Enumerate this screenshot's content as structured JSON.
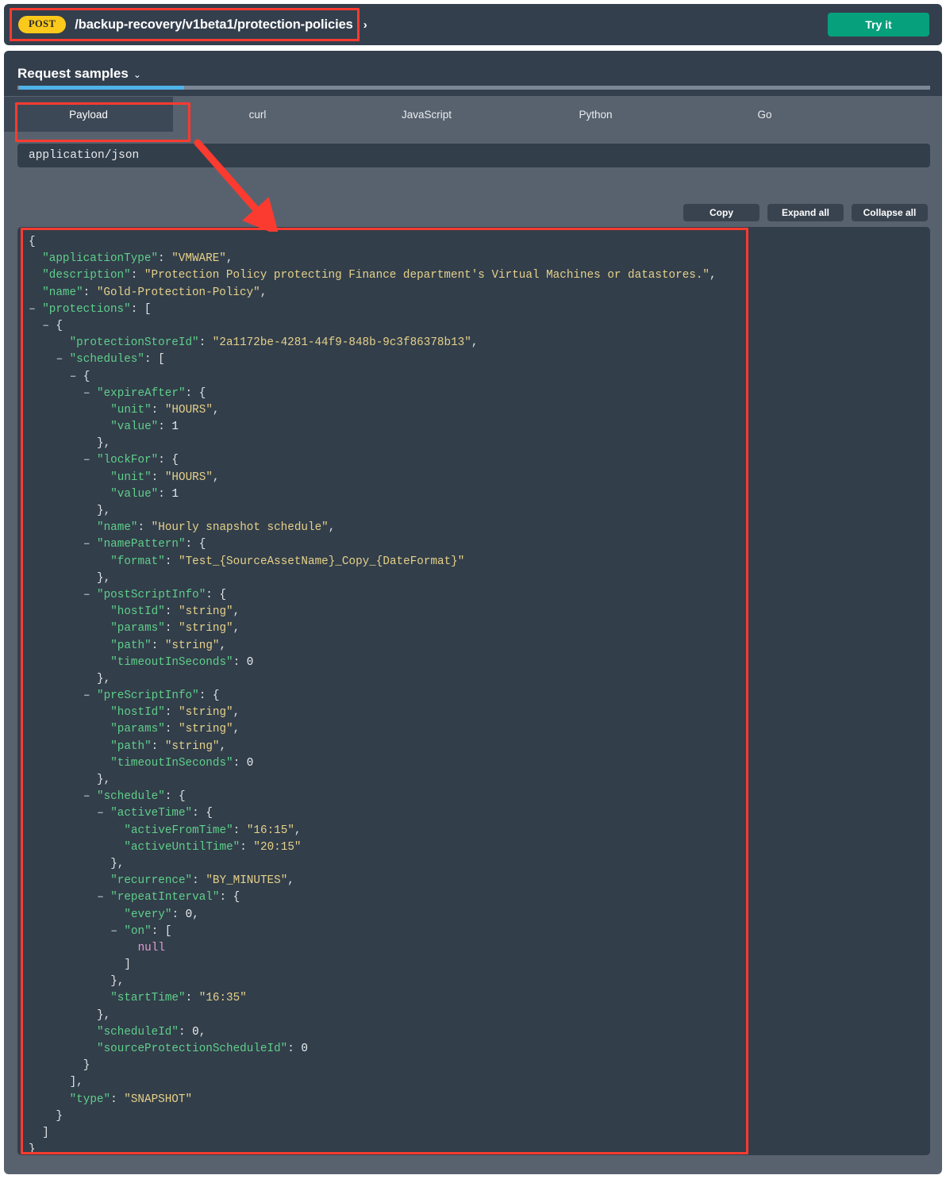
{
  "endpoint": {
    "method": "POST",
    "path": "/backup-recovery/v1beta1/protection-policies",
    "chevron": "›",
    "try_it_label": "Try it"
  },
  "samples": {
    "title": "Request samples",
    "caret": "⌄",
    "tabs": [
      {
        "label": "Payload",
        "active": true
      },
      {
        "label": "curl",
        "active": false
      },
      {
        "label": "JavaScript",
        "active": false
      },
      {
        "label": "Python",
        "active": false
      },
      {
        "label": "Go",
        "active": false
      }
    ],
    "content_type": "application/json",
    "actions": {
      "copy": "Copy",
      "expand_all": "Expand all",
      "collapse_all": "Collapse all"
    }
  },
  "colors": {
    "accent_tab": "#4fb3e8",
    "method_badge": "#fbc91b",
    "try_it": "#07a07c",
    "annotation": "#fb3b30",
    "panel_bg": "#58626f",
    "code_bg": "#323e4a",
    "key": "#5fcf8a",
    "string": "#e6d18a",
    "number": "#eef1f4",
    "null": "#e49bd4"
  },
  "code_lines": [
    {
      "fold": false,
      "indent": 0,
      "tokens": [
        {
          "t": "p",
          "v": "{"
        }
      ]
    },
    {
      "fold": false,
      "indent": 1,
      "tokens": [
        {
          "t": "k",
          "v": "\"applicationType\""
        },
        {
          "t": "p",
          "v": ": "
        },
        {
          "t": "s",
          "v": "\"VMWARE\""
        },
        {
          "t": "p",
          "v": ","
        }
      ]
    },
    {
      "fold": false,
      "indent": 1,
      "tokens": [
        {
          "t": "k",
          "v": "\"description\""
        },
        {
          "t": "p",
          "v": ": "
        },
        {
          "t": "s",
          "v": "\"Protection Policy protecting Finance department's Virtual Machines or datastores.\""
        },
        {
          "t": "p",
          "v": ","
        }
      ]
    },
    {
      "fold": false,
      "indent": 1,
      "tokens": [
        {
          "t": "k",
          "v": "\"name\""
        },
        {
          "t": "p",
          "v": ": "
        },
        {
          "t": "s",
          "v": "\"Gold-Protection-Policy\""
        },
        {
          "t": "p",
          "v": ","
        }
      ]
    },
    {
      "fold": true,
      "indent": 1,
      "tokens": [
        {
          "t": "k",
          "v": "\"protections\""
        },
        {
          "t": "p",
          "v": ": ["
        }
      ]
    },
    {
      "fold": true,
      "indent": 2,
      "tokens": [
        {
          "t": "p",
          "v": "{"
        }
      ]
    },
    {
      "fold": false,
      "indent": 3,
      "tokens": [
        {
          "t": "k",
          "v": "\"protectionStoreId\""
        },
        {
          "t": "p",
          "v": ": "
        },
        {
          "t": "s",
          "v": "\"2a1172be-4281-44f9-848b-9c3f86378b13\""
        },
        {
          "t": "p",
          "v": ","
        }
      ]
    },
    {
      "fold": true,
      "indent": 3,
      "tokens": [
        {
          "t": "k",
          "v": "\"schedules\""
        },
        {
          "t": "p",
          "v": ": ["
        }
      ]
    },
    {
      "fold": true,
      "indent": 4,
      "tokens": [
        {
          "t": "p",
          "v": "{"
        }
      ]
    },
    {
      "fold": true,
      "indent": 5,
      "tokens": [
        {
          "t": "k",
          "v": "\"expireAfter\""
        },
        {
          "t": "p",
          "v": ": {"
        }
      ]
    },
    {
      "fold": false,
      "indent": 6,
      "tokens": [
        {
          "t": "k",
          "v": "\"unit\""
        },
        {
          "t": "p",
          "v": ": "
        },
        {
          "t": "s",
          "v": "\"HOURS\""
        },
        {
          "t": "p",
          "v": ","
        }
      ]
    },
    {
      "fold": false,
      "indent": 6,
      "tokens": [
        {
          "t": "k",
          "v": "\"value\""
        },
        {
          "t": "p",
          "v": ": "
        },
        {
          "t": "n",
          "v": "1"
        }
      ]
    },
    {
      "fold": false,
      "indent": 5,
      "tokens": [
        {
          "t": "p",
          "v": "},"
        }
      ]
    },
    {
      "fold": true,
      "indent": 5,
      "tokens": [
        {
          "t": "k",
          "v": "\"lockFor\""
        },
        {
          "t": "p",
          "v": ": {"
        }
      ]
    },
    {
      "fold": false,
      "indent": 6,
      "tokens": [
        {
          "t": "k",
          "v": "\"unit\""
        },
        {
          "t": "p",
          "v": ": "
        },
        {
          "t": "s",
          "v": "\"HOURS\""
        },
        {
          "t": "p",
          "v": ","
        }
      ]
    },
    {
      "fold": false,
      "indent": 6,
      "tokens": [
        {
          "t": "k",
          "v": "\"value\""
        },
        {
          "t": "p",
          "v": ": "
        },
        {
          "t": "n",
          "v": "1"
        }
      ]
    },
    {
      "fold": false,
      "indent": 5,
      "tokens": [
        {
          "t": "p",
          "v": "},"
        }
      ]
    },
    {
      "fold": false,
      "indent": 5,
      "tokens": [
        {
          "t": "k",
          "v": "\"name\""
        },
        {
          "t": "p",
          "v": ": "
        },
        {
          "t": "s",
          "v": "\"Hourly snapshot schedule\""
        },
        {
          "t": "p",
          "v": ","
        }
      ]
    },
    {
      "fold": true,
      "indent": 5,
      "tokens": [
        {
          "t": "k",
          "v": "\"namePattern\""
        },
        {
          "t": "p",
          "v": ": {"
        }
      ]
    },
    {
      "fold": false,
      "indent": 6,
      "tokens": [
        {
          "t": "k",
          "v": "\"format\""
        },
        {
          "t": "p",
          "v": ": "
        },
        {
          "t": "s",
          "v": "\"Test_{SourceAssetName}_Copy_{DateFormat}\""
        }
      ]
    },
    {
      "fold": false,
      "indent": 5,
      "tokens": [
        {
          "t": "p",
          "v": "},"
        }
      ]
    },
    {
      "fold": true,
      "indent": 5,
      "tokens": [
        {
          "t": "k",
          "v": "\"postScriptInfo\""
        },
        {
          "t": "p",
          "v": ": {"
        }
      ]
    },
    {
      "fold": false,
      "indent": 6,
      "tokens": [
        {
          "t": "k",
          "v": "\"hostId\""
        },
        {
          "t": "p",
          "v": ": "
        },
        {
          "t": "s",
          "v": "\"string\""
        },
        {
          "t": "p",
          "v": ","
        }
      ]
    },
    {
      "fold": false,
      "indent": 6,
      "tokens": [
        {
          "t": "k",
          "v": "\"params\""
        },
        {
          "t": "p",
          "v": ": "
        },
        {
          "t": "s",
          "v": "\"string\""
        },
        {
          "t": "p",
          "v": ","
        }
      ]
    },
    {
      "fold": false,
      "indent": 6,
      "tokens": [
        {
          "t": "k",
          "v": "\"path\""
        },
        {
          "t": "p",
          "v": ": "
        },
        {
          "t": "s",
          "v": "\"string\""
        },
        {
          "t": "p",
          "v": ","
        }
      ]
    },
    {
      "fold": false,
      "indent": 6,
      "tokens": [
        {
          "t": "k",
          "v": "\"timeoutInSeconds\""
        },
        {
          "t": "p",
          "v": ": "
        },
        {
          "t": "n",
          "v": "0"
        }
      ]
    },
    {
      "fold": false,
      "indent": 5,
      "tokens": [
        {
          "t": "p",
          "v": "},"
        }
      ]
    },
    {
      "fold": true,
      "indent": 5,
      "tokens": [
        {
          "t": "k",
          "v": "\"preScriptInfo\""
        },
        {
          "t": "p",
          "v": ": {"
        }
      ]
    },
    {
      "fold": false,
      "indent": 6,
      "tokens": [
        {
          "t": "k",
          "v": "\"hostId\""
        },
        {
          "t": "p",
          "v": ": "
        },
        {
          "t": "s",
          "v": "\"string\""
        },
        {
          "t": "p",
          "v": ","
        }
      ]
    },
    {
      "fold": false,
      "indent": 6,
      "tokens": [
        {
          "t": "k",
          "v": "\"params\""
        },
        {
          "t": "p",
          "v": ": "
        },
        {
          "t": "s",
          "v": "\"string\""
        },
        {
          "t": "p",
          "v": ","
        }
      ]
    },
    {
      "fold": false,
      "indent": 6,
      "tokens": [
        {
          "t": "k",
          "v": "\"path\""
        },
        {
          "t": "p",
          "v": ": "
        },
        {
          "t": "s",
          "v": "\"string\""
        },
        {
          "t": "p",
          "v": ","
        }
      ]
    },
    {
      "fold": false,
      "indent": 6,
      "tokens": [
        {
          "t": "k",
          "v": "\"timeoutInSeconds\""
        },
        {
          "t": "p",
          "v": ": "
        },
        {
          "t": "n",
          "v": "0"
        }
      ]
    },
    {
      "fold": false,
      "indent": 5,
      "tokens": [
        {
          "t": "p",
          "v": "},"
        }
      ]
    },
    {
      "fold": true,
      "indent": 5,
      "tokens": [
        {
          "t": "k",
          "v": "\"schedule\""
        },
        {
          "t": "p",
          "v": ": {"
        }
      ]
    },
    {
      "fold": true,
      "indent": 6,
      "tokens": [
        {
          "t": "k",
          "v": "\"activeTime\""
        },
        {
          "t": "p",
          "v": ": {"
        }
      ]
    },
    {
      "fold": false,
      "indent": 7,
      "tokens": [
        {
          "t": "k",
          "v": "\"activeFromTime\""
        },
        {
          "t": "p",
          "v": ": "
        },
        {
          "t": "s",
          "v": "\"16:15\""
        },
        {
          "t": "p",
          "v": ","
        }
      ]
    },
    {
      "fold": false,
      "indent": 7,
      "tokens": [
        {
          "t": "k",
          "v": "\"activeUntilTime\""
        },
        {
          "t": "p",
          "v": ": "
        },
        {
          "t": "s",
          "v": "\"20:15\""
        }
      ]
    },
    {
      "fold": false,
      "indent": 6,
      "tokens": [
        {
          "t": "p",
          "v": "},"
        }
      ]
    },
    {
      "fold": false,
      "indent": 6,
      "tokens": [
        {
          "t": "k",
          "v": "\"recurrence\""
        },
        {
          "t": "p",
          "v": ": "
        },
        {
          "t": "s",
          "v": "\"BY_MINUTES\""
        },
        {
          "t": "p",
          "v": ","
        }
      ]
    },
    {
      "fold": true,
      "indent": 6,
      "tokens": [
        {
          "t": "k",
          "v": "\"repeatInterval\""
        },
        {
          "t": "p",
          "v": ": {"
        }
      ]
    },
    {
      "fold": false,
      "indent": 7,
      "tokens": [
        {
          "t": "k",
          "v": "\"every\""
        },
        {
          "t": "p",
          "v": ": "
        },
        {
          "t": "n",
          "v": "0"
        },
        {
          "t": "p",
          "v": ","
        }
      ]
    },
    {
      "fold": true,
      "indent": 7,
      "tokens": [
        {
          "t": "k",
          "v": "\"on\""
        },
        {
          "t": "p",
          "v": ": ["
        }
      ]
    },
    {
      "fold": false,
      "indent": 8,
      "tokens": [
        {
          "t": "nul",
          "v": "null"
        }
      ]
    },
    {
      "fold": false,
      "indent": 7,
      "tokens": [
        {
          "t": "p",
          "v": "]"
        }
      ]
    },
    {
      "fold": false,
      "indent": 6,
      "tokens": [
        {
          "t": "p",
          "v": "},"
        }
      ]
    },
    {
      "fold": false,
      "indent": 6,
      "tokens": [
        {
          "t": "k",
          "v": "\"startTime\""
        },
        {
          "t": "p",
          "v": ": "
        },
        {
          "t": "s",
          "v": "\"16:35\""
        }
      ]
    },
    {
      "fold": false,
      "indent": 5,
      "tokens": [
        {
          "t": "p",
          "v": "},"
        }
      ]
    },
    {
      "fold": false,
      "indent": 5,
      "tokens": [
        {
          "t": "k",
          "v": "\"scheduleId\""
        },
        {
          "t": "p",
          "v": ": "
        },
        {
          "t": "n",
          "v": "0"
        },
        {
          "t": "p",
          "v": ","
        }
      ]
    },
    {
      "fold": false,
      "indent": 5,
      "tokens": [
        {
          "t": "k",
          "v": "\"sourceProtectionScheduleId\""
        },
        {
          "t": "p",
          "v": ": "
        },
        {
          "t": "n",
          "v": "0"
        }
      ]
    },
    {
      "fold": false,
      "indent": 4,
      "tokens": [
        {
          "t": "p",
          "v": "}"
        }
      ]
    },
    {
      "fold": false,
      "indent": 3,
      "tokens": [
        {
          "t": "p",
          "v": "],"
        }
      ]
    },
    {
      "fold": false,
      "indent": 3,
      "tokens": [
        {
          "t": "k",
          "v": "\"type\""
        },
        {
          "t": "p",
          "v": ": "
        },
        {
          "t": "s",
          "v": "\"SNAPSHOT\""
        }
      ]
    },
    {
      "fold": false,
      "indent": 2,
      "tokens": [
        {
          "t": "p",
          "v": "}"
        }
      ]
    },
    {
      "fold": false,
      "indent": 1,
      "tokens": [
        {
          "t": "p",
          "v": "]"
        }
      ]
    },
    {
      "fold": false,
      "indent": 0,
      "tokens": [
        {
          "t": "p",
          "v": "}"
        }
      ]
    }
  ]
}
